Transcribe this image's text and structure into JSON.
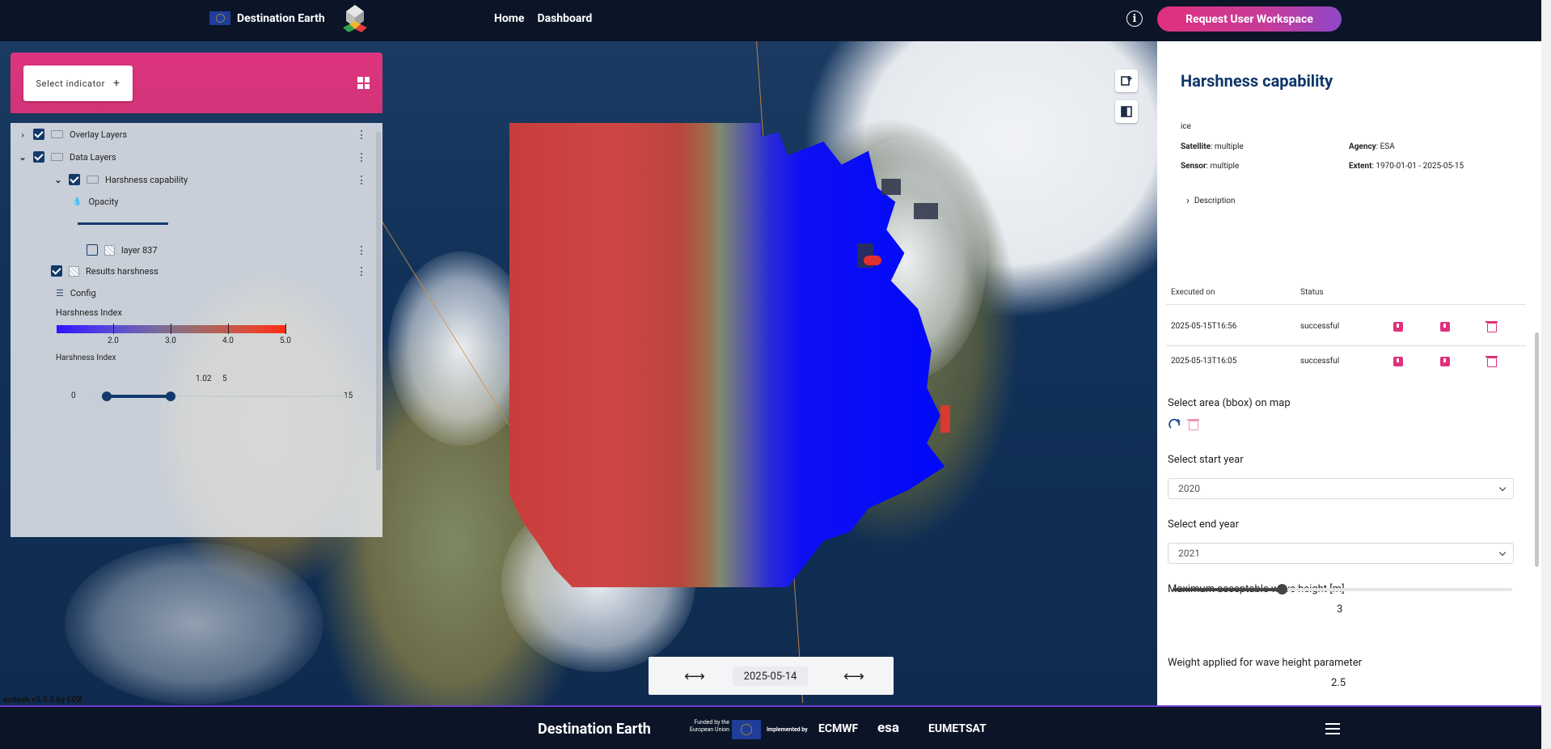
{
  "header": {
    "brand": "Destination Earth",
    "nav": [
      "Home",
      "Dashboard"
    ],
    "info_icon": "info-icon",
    "workspace_button": "Request User Workspace"
  },
  "left_panel": {
    "select_indicator": "Select indicator",
    "layers": {
      "overlay": "Overlay Layers",
      "data": "Data Layers",
      "harshness": "Harshness capability",
      "opacity": "Opacity",
      "layer837": "layer 837",
      "results": "Results harshness",
      "config": "Config"
    },
    "legend": {
      "title": "Harshness Index",
      "ticks": [
        "2.0",
        "3.0",
        "4.0",
        "5.0"
      ]
    },
    "range": {
      "title": "Harshness Index",
      "min": "0",
      "max": "15",
      "low_value": "1.02",
      "high_value": "5"
    },
    "colors": {
      "header": "#dd357f",
      "accent": "#133a6b"
    }
  },
  "right_panel": {
    "title": "Harshness capability",
    "theme": "ice",
    "satellite_label": "Satellite",
    "satellite_value": ": multiple",
    "sensor_label": "Sensor",
    "sensor_value": ": multiple",
    "agency_label": "Agency",
    "agency_value": ": ESA",
    "extent_label": "Extent",
    "extent_value": ": 1970-01-01 - 2025-05-15",
    "description": "Description",
    "table": {
      "headers": [
        "Executed on",
        "Status"
      ],
      "rows": [
        {
          "executed": "2025-05-15T16:56",
          "status": "successful"
        },
        {
          "executed": "2025-05-13T16:05",
          "status": "successful"
        }
      ]
    },
    "bbox_label": "Select area (bbox) on map",
    "start_year_label": "Select start year",
    "start_year": "2020",
    "end_year_label": "Select end year",
    "end_year": "2021",
    "wave_label": "Maximum acceptable wave height [m]",
    "wave_value": "3",
    "wave_fraction": 0.33,
    "weight_label": "Weight applied for wave height parameter",
    "weight_value": "2.5"
  },
  "time": {
    "date": "2025-05-14",
    "prev": "⟷",
    "next": "⟷"
  },
  "version": "eodash v5.0.0 by EOX",
  "footer": {
    "brand": "Destination Earth",
    "funded_by": "Funded by the European Union",
    "implemented_by": "Implemented by",
    "partners": [
      "ECMWF",
      "esa",
      "EUMETSAT"
    ]
  }
}
